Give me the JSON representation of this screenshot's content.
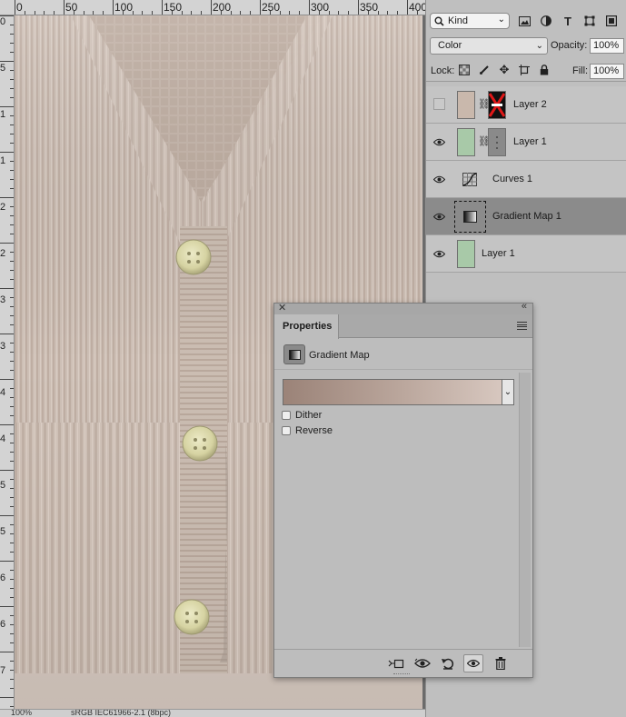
{
  "ruler": {
    "top_labels": [
      "0",
      "50",
      "100",
      "150",
      "200",
      "250",
      "300",
      "350",
      "400"
    ],
    "left_labels": [
      "0",
      "5",
      "1",
      "1",
      "2",
      "2",
      "3",
      "3",
      "4",
      "4",
      "5",
      "5",
      "6",
      "6",
      "7"
    ]
  },
  "status": {
    "zoom": "100%",
    "profile": "sRGB IEC61966-2.1 (8bpc)"
  },
  "layers_panel": {
    "filter": {
      "kind_label": "Kind",
      "filter_icons": [
        "image-filter-icon",
        "adjustment-filter-icon",
        "type-filter-icon",
        "shape-filter-icon",
        "smart-object-filter-icon"
      ]
    },
    "blend_mode": "Color",
    "opacity_label": "Opacity:",
    "opacity_value": "100%",
    "lock_label": "Lock:",
    "fill_label": "Fill:",
    "fill_value": "100%",
    "layers": [
      {
        "name": "Layer 2",
        "visible": false,
        "thumb_color": "#c9b8ac",
        "has_mask": true
      },
      {
        "name": "Layer 1",
        "visible": true,
        "thumb_color": "#a8c9a8",
        "has_mask": true
      },
      {
        "name": "Curves 1",
        "visible": true,
        "thumb_color": "",
        "has_mask": false
      },
      {
        "name": "Gradient Map 1",
        "visible": true,
        "thumb_color": "",
        "has_mask": false,
        "selected": true
      },
      {
        "name": "Layer 1",
        "visible": true,
        "thumb_color": "#a8c9a8",
        "has_mask": false
      }
    ]
  },
  "properties_panel": {
    "tab_label": "Properties",
    "adjustment_label": "Gradient Map",
    "gradient_colors": [
      "#9b8378",
      "#bba79d",
      "#d7c7bf"
    ],
    "dither_label": "Dither",
    "dither_checked": false,
    "reverse_label": "Reverse",
    "reverse_checked": false,
    "footer_buttons": [
      "clip-to-layer-icon",
      "view-previous-state-icon",
      "reset-icon",
      "toggle-visibility-icon",
      "delete-icon"
    ]
  },
  "colors": {
    "knit_base": "#cdbfb5",
    "knit_shadow": "#b8a89d",
    "button_fill": "#d9d6a8"
  }
}
